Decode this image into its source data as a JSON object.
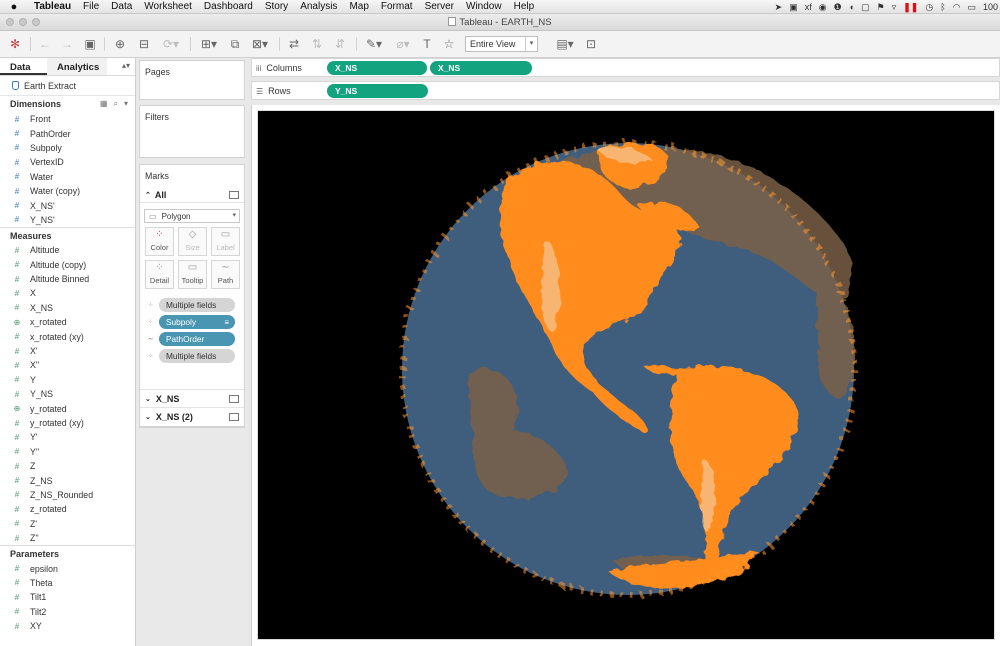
{
  "menubar": {
    "apple": "",
    "items": [
      "Tableau",
      "File",
      "Data",
      "Worksheet",
      "Dashboard",
      "Story",
      "Analysis",
      "Map",
      "Format",
      "Server",
      "Window",
      "Help"
    ],
    "battery": "100"
  },
  "window": {
    "title": "Tableau - EARTH_NS"
  },
  "toolbar": {
    "view_select": "Entire View"
  },
  "datapane": {
    "tabs": {
      "data": "Data",
      "analytics": "Analytics"
    },
    "source": "Earth Extract",
    "dimensions_header": "Dimensions",
    "dimensions": [
      {
        "label": "Front",
        "icon": "#"
      },
      {
        "label": "PathOrder",
        "icon": "#"
      },
      {
        "label": "Subpoly",
        "icon": "#"
      },
      {
        "label": "VertexID",
        "icon": "#"
      },
      {
        "label": "Water",
        "icon": "#"
      },
      {
        "label": "Water (copy)",
        "icon": "#"
      },
      {
        "label": "X_NS'",
        "icon": "#"
      },
      {
        "label": "Y_NS'",
        "icon": "#"
      }
    ],
    "measures_header": "Measures",
    "measures": [
      {
        "label": "Altitude",
        "icon": "#"
      },
      {
        "label": "Altitude (copy)",
        "icon": "#"
      },
      {
        "label": "Altitude Binned",
        "icon": "#"
      },
      {
        "label": "X",
        "icon": "#"
      },
      {
        "label": "X_NS",
        "icon": "#"
      },
      {
        "label": "x_rotated",
        "icon": "⊕"
      },
      {
        "label": "x_rotated (xy)",
        "icon": "#"
      },
      {
        "label": "X'",
        "icon": "#"
      },
      {
        "label": "X''",
        "icon": "#"
      },
      {
        "label": "Y",
        "icon": "#"
      },
      {
        "label": "Y_NS",
        "icon": "#"
      },
      {
        "label": "y_rotated",
        "icon": "⊕"
      },
      {
        "label": "y_rotated (xy)",
        "icon": "#"
      },
      {
        "label": "Y'",
        "icon": "#"
      },
      {
        "label": "Y''",
        "icon": "#"
      },
      {
        "label": "Z",
        "icon": "#"
      },
      {
        "label": "Z_NS",
        "icon": "#"
      },
      {
        "label": "Z_NS_Rounded",
        "icon": "#"
      },
      {
        "label": "z_rotated",
        "icon": "#"
      },
      {
        "label": "Z'",
        "icon": "#"
      },
      {
        "label": "Z''",
        "icon": "#"
      }
    ],
    "parameters_header": "Parameters",
    "parameters": [
      {
        "label": "epsilon",
        "icon": "#"
      },
      {
        "label": "Theta",
        "icon": "#"
      },
      {
        "label": "Tilt1",
        "icon": "#"
      },
      {
        "label": "Tilt2",
        "icon": "#"
      },
      {
        "label": "XY",
        "icon": "#"
      }
    ]
  },
  "cards": {
    "pages": "Pages",
    "filters": "Filters",
    "marks": "Marks",
    "all": "All",
    "mark_type": "Polygon",
    "buttons": [
      "Color",
      "Size",
      "Label",
      "Detail",
      "Tooltip",
      "Path"
    ],
    "mark_fields": [
      {
        "label": "Multiple fields",
        "style": "gray",
        "icon": "⁘"
      },
      {
        "label": "Subpoly",
        "style": "blue",
        "icon": "⁘"
      },
      {
        "label": "PathOrder",
        "style": "blue",
        "icon": "∼"
      },
      {
        "label": "Multiple fields",
        "style": "gray",
        "icon": "⁘"
      }
    ],
    "sheets": [
      "X_NS",
      "X_NS (2)"
    ]
  },
  "shelves": {
    "columns_label": "Columns",
    "columns": [
      "X_NS",
      "X_NS"
    ],
    "rows_label": "Rows",
    "rows": [
      "Y_NS"
    ]
  },
  "colors": {
    "land": "#ff8c1a",
    "ocean": "#3f5d7d",
    "background": "#000000",
    "pill_green": "#14a37f",
    "pill_blue": "#4996b2"
  }
}
